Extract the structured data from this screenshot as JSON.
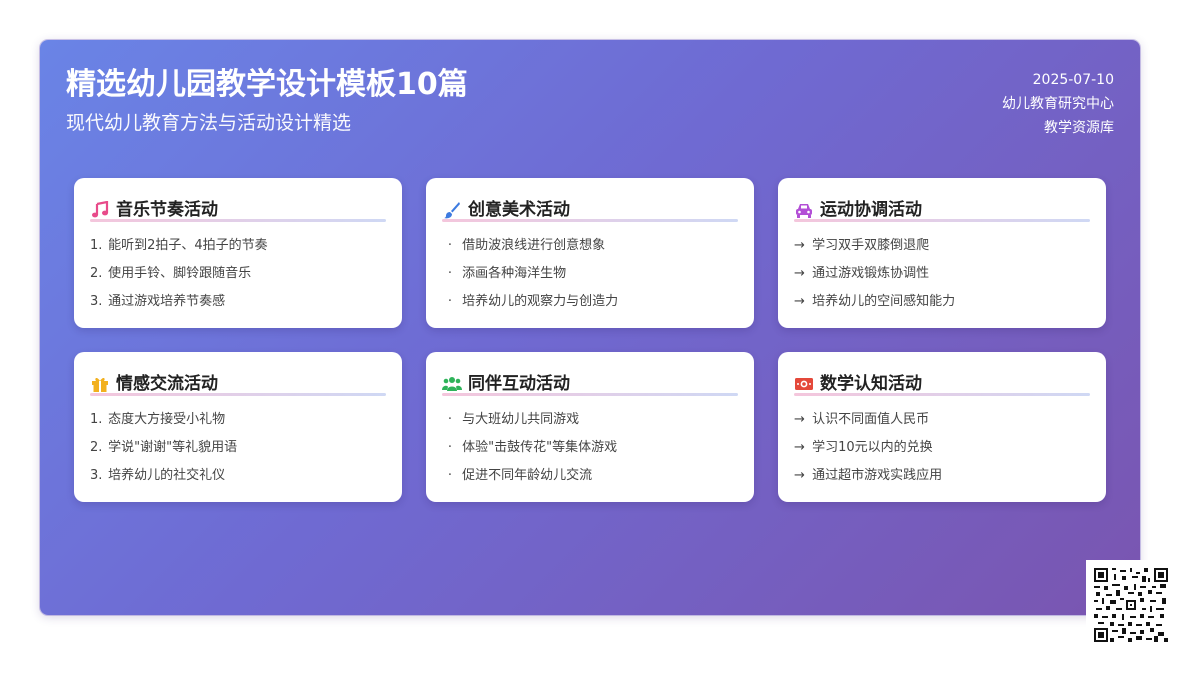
{
  "header": {
    "title": "精选幼儿园教学设计模板10篇",
    "subtitle": "现代幼儿教育方法与活动设计精选",
    "date": "2025-07-10",
    "org": "幼儿教育研究中心",
    "source": "教学资源库"
  },
  "cards": [
    {
      "icon": "music-note-icon",
      "icon_color": "#e84b8a",
      "title": "音乐节奏活动",
      "list_style": "numbered",
      "items": [
        "能听到2拍子、4拍子的节奏",
        "使用手铃、脚铃跟随音乐",
        "通过游戏培养节奏感"
      ]
    },
    {
      "icon": "paintbrush-icon",
      "icon_color": "#3d7be0",
      "title": "创意美术活动",
      "list_style": "dot",
      "items": [
        "借助波浪线进行创意想象",
        "添画各种海洋生物",
        "培养幼儿的观察力与创造力"
      ]
    },
    {
      "icon": "car-icon",
      "icon_color": "#b34fd6",
      "title": "运动协调活动",
      "list_style": "arrow",
      "items": [
        "学习双手双膝倒退爬",
        "通过游戏锻炼协调性",
        "培养幼儿的空间感知能力"
      ]
    },
    {
      "icon": "gift-icon",
      "icon_color": "#f2b01e",
      "title": "情感交流活动",
      "list_style": "numbered",
      "items": [
        "态度大方接受小礼物",
        "学说\"谢谢\"等礼貌用语",
        "培养幼儿的社交礼仪"
      ]
    },
    {
      "icon": "users-icon",
      "icon_color": "#2fb35a",
      "title": "同伴互动活动",
      "list_style": "dot",
      "items": [
        "与大班幼儿共同游戏",
        "体验\"击鼓传花\"等集体游戏",
        "促进不同年龄幼儿交流"
      ]
    },
    {
      "icon": "money-icon",
      "icon_color": "#e4483a",
      "title": "数学认知活动",
      "list_style": "arrow",
      "items": [
        "认识不同面值人民币",
        "学习10元以内的兑换",
        "通过超市游戏实践应用"
      ]
    }
  ],
  "list_marks": {
    "numbered": [
      "1.",
      "2.",
      "3."
    ],
    "dot": [
      "·",
      "·",
      "·"
    ],
    "arrow": [
      "→",
      "→",
      "→"
    ]
  },
  "qr": {
    "icon": "qr-code-icon"
  }
}
